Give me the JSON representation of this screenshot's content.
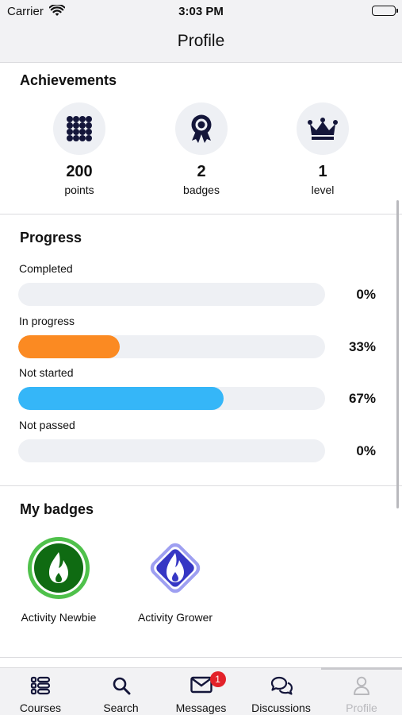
{
  "status_bar": {
    "carrier": "Carrier",
    "time": "3:03 PM"
  },
  "nav": {
    "title": "Profile"
  },
  "achievements": {
    "title": "Achievements",
    "items": [
      {
        "value": "200",
        "label": "points",
        "icon": "grid-dots-icon"
      },
      {
        "value": "2",
        "label": "badges",
        "icon": "award-ribbon-icon"
      },
      {
        "value": "1",
        "label": "level",
        "icon": "crown-icon"
      }
    ]
  },
  "progress": {
    "title": "Progress",
    "items": [
      {
        "label": "Completed",
        "percent_text": "0%",
        "fraction": 0,
        "color": "#eef0f4"
      },
      {
        "label": "In progress",
        "percent_text": "33%",
        "fraction": 0.33,
        "color": "#fb8a22"
      },
      {
        "label": "Not started",
        "percent_text": "67%",
        "fraction": 0.67,
        "color": "#35b6f8"
      },
      {
        "label": "Not passed",
        "percent_text": "0%",
        "fraction": 0,
        "color": "#eef0f4"
      }
    ]
  },
  "badges": {
    "title": "My badges",
    "items": [
      {
        "label": "Activity Newbie",
        "icon": "flame-icon",
        "color": "#0f6b12"
      },
      {
        "label": "Activity Grower",
        "icon": "flame-icon",
        "color": "#3637c4"
      }
    ]
  },
  "tabs": [
    {
      "label": "Courses",
      "icon": "courses-list-icon",
      "active": false
    },
    {
      "label": "Search",
      "icon": "search-icon",
      "active": false
    },
    {
      "label": "Messages",
      "icon": "envelope-icon",
      "active": false,
      "badge": "1"
    },
    {
      "label": "Discussions",
      "icon": "chat-bubbles-icon",
      "active": false
    },
    {
      "label": "Profile",
      "icon": "person-icon",
      "active": true
    }
  ],
  "colors": {
    "accent_orange": "#fb8a22",
    "accent_blue": "#35b6f8",
    "icon_navy": "#14163a",
    "notification_red": "#e3222a"
  }
}
